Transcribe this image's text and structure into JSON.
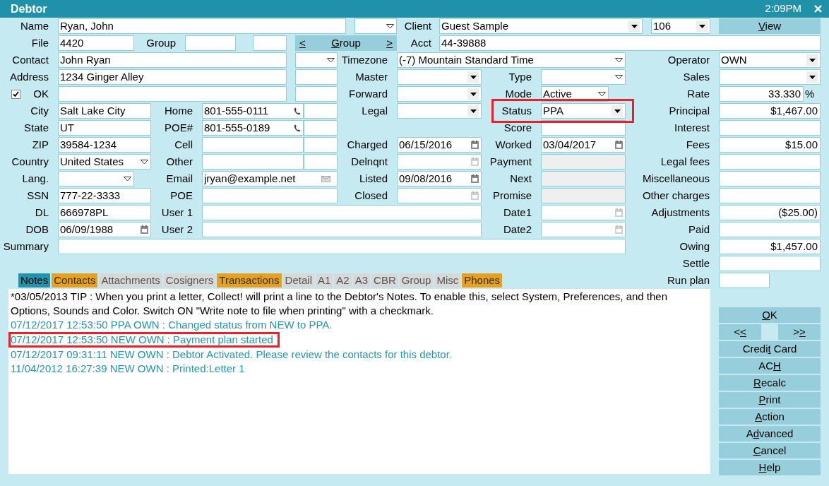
{
  "window": {
    "title": "Debtor",
    "time": "2:09PM"
  },
  "rows": [
    {
      "items": [
        {
          "kind": "label",
          "text": "Name"
        },
        {
          "kind": "text",
          "value": "Ryan, John"
        },
        {
          "kind": "combo"
        },
        {
          "kind": "label",
          "text": "Client"
        },
        {
          "kind": "select",
          "value": "Guest Sample"
        },
        {
          "kind": "select",
          "value": "106"
        },
        {
          "kind": "button",
          "key": "V",
          "rest": "iew"
        }
      ]
    },
    {
      "items": [
        {
          "kind": "label",
          "text": "File"
        },
        {
          "kind": "text",
          "value": "4420"
        },
        {
          "kind": "label",
          "text": "Group"
        },
        {
          "kind": "text"
        },
        {
          "kind": "text"
        },
        {
          "kind": "nav",
          "buttons": [
            {
              "key": "<"
            },
            {
              "key": "G",
              "rest": "roup"
            },
            {
              "key": ">"
            }
          ]
        },
        {
          "kind": "label",
          "text": "Acct"
        },
        {
          "kind": "text",
          "value": "44-39888"
        }
      ]
    },
    {
      "items": [
        {
          "kind": "label",
          "text": "Contact"
        },
        {
          "kind": "text",
          "value": "John Ryan"
        },
        {
          "kind": "combo"
        },
        {
          "kind": "label",
          "text": "Timezone"
        },
        {
          "kind": "combo",
          "value": "(-7) Mountain Standard Time"
        },
        {
          "kind": "label",
          "text": "Operator"
        },
        {
          "kind": "select",
          "value": "OWN"
        }
      ]
    },
    {
      "items": [
        {
          "kind": "label",
          "text": "Address"
        },
        {
          "kind": "text",
          "value": "1234 Ginger Alley"
        },
        {
          "kind": "text"
        },
        {
          "kind": "label",
          "text": "Master"
        },
        {
          "kind": "select"
        },
        {
          "kind": "label",
          "text": "Type"
        },
        {
          "kind": "combo"
        },
        {
          "kind": "label",
          "text": "Sales"
        },
        {
          "kind": "select"
        }
      ]
    },
    {
      "items": [
        {
          "kind": "checkbox",
          "label": "OK",
          "checked": true
        },
        {
          "kind": "text"
        },
        {
          "kind": "text"
        },
        {
          "kind": "label",
          "text": "Forward"
        },
        {
          "kind": "select"
        },
        {
          "kind": "label",
          "text": "Mode"
        },
        {
          "kind": "combo",
          "value": "Active"
        },
        {
          "kind": "label",
          "text": "Rate"
        },
        {
          "kind": "amount",
          "value": "33.330"
        },
        {
          "kind": "unit",
          "text": "%"
        }
      ]
    },
    {
      "items": [
        {
          "kind": "label",
          "text": "City"
        },
        {
          "kind": "text",
          "value": "Salt Lake City"
        },
        {
          "kind": "label",
          "text": "Home"
        },
        {
          "kind": "phone",
          "value": "801-555-0111"
        },
        {
          "kind": "text"
        },
        {
          "kind": "label",
          "text": "Legal"
        },
        {
          "kind": "select"
        },
        {
          "kind": "label",
          "text": "Status"
        },
        {
          "kind": "select",
          "value": "PPA",
          "highlighted": true
        },
        {
          "kind": "label",
          "text": "Principal"
        },
        {
          "kind": "amount",
          "value": "$1,467.00"
        }
      ]
    },
    {
      "items": [
        {
          "kind": "label",
          "text": "State"
        },
        {
          "kind": "text",
          "value": "UT"
        },
        {
          "kind": "label",
          "text": "POE#"
        },
        {
          "kind": "phone",
          "value": "801-555-0189"
        },
        {
          "kind": "text"
        },
        {
          "kind": "label",
          "text": "Score"
        },
        {
          "kind": "text"
        },
        {
          "kind": "label",
          "text": "Interest"
        },
        {
          "kind": "amount"
        }
      ]
    },
    {
      "items": [
        {
          "kind": "label",
          "text": "ZIP"
        },
        {
          "kind": "text",
          "value": "39584-1234"
        },
        {
          "kind": "label",
          "text": "Cell"
        },
        {
          "kind": "text"
        },
        {
          "kind": "text"
        },
        {
          "kind": "label",
          "text": "Charged"
        },
        {
          "kind": "date",
          "value": "06/15/2016"
        },
        {
          "kind": "label",
          "text": "Worked"
        },
        {
          "kind": "date",
          "value": "03/04/2017"
        },
        {
          "kind": "label",
          "text": "Fees"
        },
        {
          "kind": "amount",
          "value": "$15.00"
        }
      ]
    },
    {
      "items": [
        {
          "kind": "label",
          "text": "Country"
        },
        {
          "kind": "combo",
          "value": "United States"
        },
        {
          "kind": "label",
          "text": "Other"
        },
        {
          "kind": "text"
        },
        {
          "kind": "text"
        },
        {
          "kind": "label",
          "text": "Delnqnt"
        },
        {
          "kind": "date"
        },
        {
          "kind": "label",
          "text": "Payment"
        },
        {
          "kind": "readonly"
        },
        {
          "kind": "label",
          "text": "Legal fees"
        },
        {
          "kind": "amount"
        }
      ]
    },
    {
      "items": [
        {
          "kind": "label",
          "text": "Lang."
        },
        {
          "kind": "combo"
        },
        {
          "kind": "label",
          "text": "Email"
        },
        {
          "kind": "email",
          "value": "jryan@example.net"
        },
        {
          "kind": "label",
          "text": "Listed"
        },
        {
          "kind": "date",
          "value": "09/08/2016"
        },
        {
          "kind": "label",
          "text": "Next"
        },
        {
          "kind": "readonly"
        },
        {
          "kind": "label",
          "text": "Miscellaneous"
        },
        {
          "kind": "amount"
        }
      ]
    },
    {
      "items": [
        {
          "kind": "label",
          "text": "SSN"
        },
        {
          "kind": "text",
          "value": "777-22-3333"
        },
        {
          "kind": "label",
          "text": "POE"
        },
        {
          "kind": "text"
        },
        {
          "kind": "label",
          "text": "Closed"
        },
        {
          "kind": "date"
        },
        {
          "kind": "label",
          "text": "Promise"
        },
        {
          "kind": "readonly"
        },
        {
          "kind": "label",
          "text": "Other charges"
        },
        {
          "kind": "amount"
        }
      ]
    },
    {
      "items": [
        {
          "kind": "label",
          "text": "DL"
        },
        {
          "kind": "text",
          "value": "666978PL"
        },
        {
          "kind": "label",
          "text": "User 1"
        },
        {
          "kind": "text"
        },
        {
          "kind": "label",
          "text": "Date1"
        },
        {
          "kind": "date"
        },
        {
          "kind": "label",
          "text": "Adjustments"
        },
        {
          "kind": "amount",
          "value": "($25.00)"
        }
      ]
    },
    {
      "items": [
        {
          "kind": "label",
          "text": "DOB"
        },
        {
          "kind": "date",
          "value": "06/09/1988"
        },
        {
          "kind": "label",
          "text": "User 2"
        },
        {
          "kind": "text"
        },
        {
          "kind": "label",
          "text": "Date2"
        },
        {
          "kind": "date"
        },
        {
          "kind": "label",
          "text": "Paid"
        },
        {
          "kind": "amount"
        }
      ]
    },
    {
      "items": [
        {
          "kind": "label",
          "text": "Summary"
        },
        {
          "kind": "text"
        },
        {
          "kind": "label",
          "text": "Owing"
        },
        {
          "kind": "amount",
          "value": "$1,457.00"
        }
      ]
    },
    {
      "items": [
        {
          "kind": "label",
          "text": "Settle"
        },
        {
          "kind": "amount"
        }
      ]
    },
    {
      "items": [
        {
          "kind": "label",
          "text": "Run plan"
        },
        {
          "kind": "text"
        }
      ]
    }
  ],
  "tabs": [
    {
      "label": "Notes",
      "selected": true,
      "has_data": false
    },
    {
      "label": "Contacts",
      "selected": false,
      "has_data": true
    },
    {
      "label": "Attachments",
      "selected": false,
      "has_data": false
    },
    {
      "label": "Cosigners",
      "selected": false,
      "has_data": false
    },
    {
      "label": "Transactions",
      "selected": false,
      "has_data": true
    },
    {
      "label": "Detail",
      "selected": false,
      "has_data": false
    },
    {
      "label": "A1",
      "selected": false,
      "has_data": false
    },
    {
      "label": "A2",
      "selected": false,
      "has_data": false
    },
    {
      "label": "A3",
      "selected": false,
      "has_data": false
    },
    {
      "label": "CBR",
      "selected": false,
      "has_data": false
    },
    {
      "label": "Group",
      "selected": false,
      "has_data": false
    },
    {
      "label": "Misc",
      "selected": false,
      "has_data": false
    },
    {
      "label": "Phones",
      "selected": false,
      "has_data": true
    }
  ],
  "notes": [
    {
      "kind": "tip",
      "text": "*03/05/2013 TIP : When you print a letter, Collect! will print a line to the Debtor's Notes. To enable this, select System, Preferences, and then Options, Sounds and Color. Switch ON \"Write note to file when printing\" with a checkmark.",
      "highlighted": false
    },
    {
      "kind": "log",
      "text": "07/12/2017 12:53:50 PPA OWN : Changed status from NEW to PPA.",
      "highlighted": false
    },
    {
      "kind": "log",
      "text": "07/12/2017 12:53:50 NEW OWN : Payment plan started",
      "highlighted": true
    },
    {
      "kind": "log",
      "text": "07/12/2017 09:31:11 NEW OWN : Debtor Activated. Please review the contacts for this debtor.",
      "highlighted": false
    },
    {
      "kind": "log",
      "text": "11/04/2012 16:27:39 NEW OWN : Printed:Letter 1",
      "highlighted": false
    }
  ],
  "actions": [
    {
      "kind": "button",
      "key": "O",
      "rest": "K"
    },
    {
      "kind": "pair",
      "buttons": [
        {
          "pre": "<",
          "key": "<"
        },
        {
          "pre": ">",
          "key": ">"
        }
      ]
    },
    {
      "kind": "button",
      "pre": "Credi",
      "key": "t",
      "rest": " Card"
    },
    {
      "kind": "button",
      "pre": "AC",
      "key": "H"
    },
    {
      "kind": "button",
      "key": "R",
      "rest": "ecalc"
    },
    {
      "kind": "button",
      "key": "P",
      "rest": "rint"
    },
    {
      "kind": "button",
      "key": "A",
      "rest": "ction"
    },
    {
      "kind": "button",
      "pre": "A",
      "key": "d",
      "rest": "vanced"
    },
    {
      "kind": "button",
      "key": "C",
      "rest": "ancel"
    },
    {
      "kind": "button",
      "key": "H",
      "rest": "elp"
    }
  ]
}
